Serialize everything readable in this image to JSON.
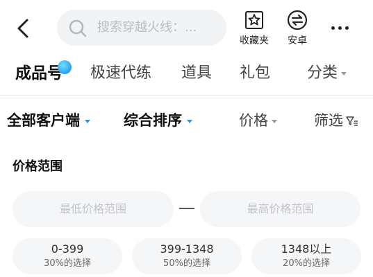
{
  "header": {
    "search_placeholder": "搜索穿越火线：...",
    "favorites_label": "收藏夹",
    "android_label": "安卓"
  },
  "categories": [
    {
      "label": "成品号",
      "active": true
    },
    {
      "label": "极速代练"
    },
    {
      "label": "道具"
    },
    {
      "label": "礼包"
    },
    {
      "label": "分类"
    }
  ],
  "filters": {
    "client": "全部客户端",
    "sort": "综合排序",
    "price": "价格",
    "screen": "筛选"
  },
  "price_range": {
    "title": "价格范围",
    "min_placeholder": "最低价格范围",
    "max_placeholder": "最高价格范围",
    "presets": [
      {
        "range": "0-399",
        "share": "30%的选择"
      },
      {
        "range": "399-1348",
        "share": "50%的选择"
      },
      {
        "range": "1348以上",
        "share": "20%的选择"
      }
    ]
  },
  "colors": {
    "accent": "#1e9bf0",
    "input_bg": "#f5f6f8"
  }
}
